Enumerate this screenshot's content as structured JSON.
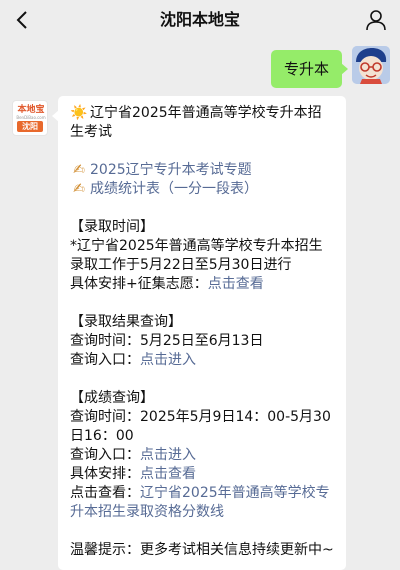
{
  "nav": {
    "title": "沈阳本地宝",
    "back_icon": "chevron-left-icon",
    "user_icon": "user-icon"
  },
  "sent_message": {
    "text": "专升本",
    "bubble_color": "#95ec69"
  },
  "business": {
    "logo_text": "本地宝",
    "logo_sub": "BenDiBao.com",
    "logo_badge": "沈阳",
    "accent": "#e8692c"
  },
  "reply": {
    "heading_emoji": "☀️",
    "heading": "辽宁省2025年普通高等学校专升本招生考试",
    "links": [
      {
        "emoji": "✍",
        "text": "2025辽宁专升本考试专题"
      },
      {
        "emoji": "✍",
        "text": "成绩统计表（一分一段表）"
      }
    ],
    "admission": {
      "header": "【录取时间】",
      "body": "*辽宁省2025年普通高等学校专升本招生录取工作于5月22日至5月30日进行",
      "detail_label": "具体安排+征集志愿：",
      "detail_link": "点击查看"
    },
    "result_query": {
      "header": "【录取结果查询】",
      "time_label": "查询时间：",
      "time_value": "5月25日至6月13日",
      "entry_label": "查询入口：",
      "entry_link": "点击进入"
    },
    "score_query": {
      "header": "【成绩查询】",
      "time_label": "查询时间：",
      "time_value": "2025年5月9日14：00-5月30日16：00",
      "entry_label": "查询入口：",
      "entry_link": "点击进入",
      "plan_label": "具体安排：",
      "plan_link": "点击查看",
      "view_label": "点击查看：",
      "view_link": "辽宁省2025年普通高等学校专升本招生录取资格分数线"
    },
    "tip": "温馨提示：更多考试相关信息持续更新中~",
    "link_color": "#576b95"
  }
}
